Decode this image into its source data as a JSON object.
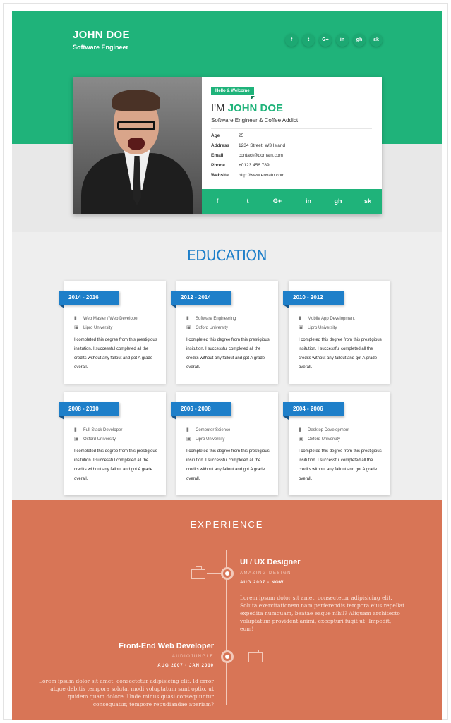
{
  "header": {
    "name": "JOHN DOE",
    "role": "Software Engineer",
    "social": [
      "f",
      "t",
      "G+",
      "in",
      "gh",
      "sk"
    ]
  },
  "profile": {
    "tag": "Hello & Welcome",
    "greeting_prefix": "I'M",
    "greeting_name": "JOHN DOE",
    "tagline": "Software Engineer & Coffee Addict",
    "info": [
      {
        "label": "Age",
        "value": "25"
      },
      {
        "label": "Address",
        "value": "1234 Street, W3 Island"
      },
      {
        "label": "Email",
        "value": "contact@domain.com"
      },
      {
        "label": "Phone",
        "value": "+0123 456 789"
      },
      {
        "label": "Website",
        "value": "http://www.envato.com"
      }
    ],
    "social_bar": [
      "f",
      "t",
      "G+",
      "in",
      "gh",
      "sk"
    ]
  },
  "education": {
    "title": "EDUCATION",
    "items": [
      {
        "years": "2014 - 2016",
        "course": "Web Master / Web Developer",
        "school": "Lipro University",
        "desc": "I completed this degree from this prestigious insitution. I successful completed all the credits without any fallout and got A grade overall."
      },
      {
        "years": "2012 - 2014",
        "course": "Software Engineering",
        "school": "Oxford University",
        "desc": "I completed this degree from this prestigious insitution. I successful completed all the credits without any fallout and got A grade overall."
      },
      {
        "years": "2010 - 2012",
        "course": "Mobile App Development",
        "school": "Lipro University",
        "desc": "I completed this degree from this prestigious insitution. I successful completed all the credits without any fallout and got A grade overall."
      },
      {
        "years": "2008 - 2010",
        "course": "Full Stack Developer",
        "school": "Oxford University",
        "desc": "I completed this degree from this prestigious insitution. I successful completed all the credits without any fallout and got A grade overall."
      },
      {
        "years": "2006 - 2008",
        "course": "Computer Science",
        "school": "Lipro University",
        "desc": "I completed this degree from this prestigious insitution. I successful completed all the credits without any fallout and got A grade overall."
      },
      {
        "years": "2004 - 2006",
        "course": "Desktop Development",
        "school": "Oxford University",
        "desc": "I completed this degree from this prestigious insitution. I successful completed all the credits without any fallout and got A grade overall."
      }
    ]
  },
  "experience": {
    "title": "EXPERIENCE",
    "jobs": [
      {
        "title": "UI / UX Designer",
        "company": "AMAZING DESIGN",
        "dates": "AUG 2007 - NOW",
        "desc": "Lorem ipsum dolor sit amet, consectetur adipisicing elit. Soluta exercitationem nam perferendis tempora eius repellat expedita numquam, beatae eaque nihil? Aliquam architecto voluptatum provident animi, excepturi fugit ut! Impedit, eum!"
      },
      {
        "title": "Front-End Web Developer",
        "company": "AUDIOJUNGLE",
        "dates": "AUG 2007 - JAN 2010",
        "desc": "Lorem ipsum dolor sit amet, consectetur adipisicing elit. Id error atque debitis tempora soluta, modi voluptatum sunt optio, ut quidem quam dolore. Unde minus quasi consequuntur consequatur, tempore repudiandae aperiam?"
      }
    ]
  },
  "colors": {
    "green": "#1fb37a",
    "blue": "#1e7fc9",
    "orange": "#d87556"
  }
}
